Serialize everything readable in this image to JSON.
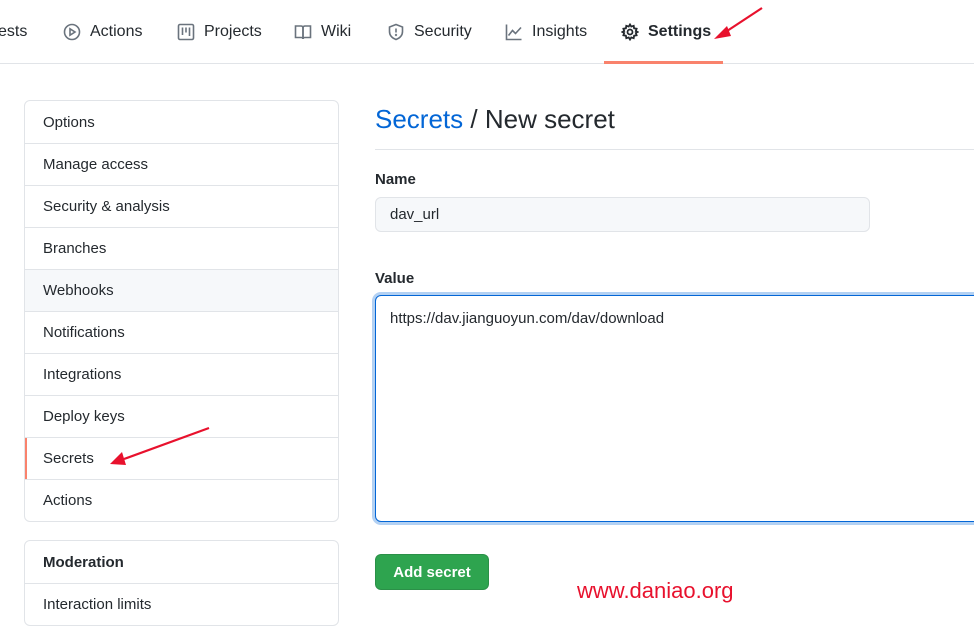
{
  "repo_nav": {
    "tabs": [
      {
        "label": "ests",
        "icon": "pull-request-icon"
      },
      {
        "label": "Actions",
        "icon": "play-icon"
      },
      {
        "label": "Projects",
        "icon": "project-board-icon"
      },
      {
        "label": "Wiki",
        "icon": "book-icon"
      },
      {
        "label": "Security",
        "icon": "shield-icon"
      },
      {
        "label": "Insights",
        "icon": "graph-icon"
      },
      {
        "label": "Settings",
        "icon": "gear-icon",
        "selected": true
      }
    ]
  },
  "sidebar": {
    "items": [
      {
        "label": "Options"
      },
      {
        "label": "Manage access"
      },
      {
        "label": "Security & analysis"
      },
      {
        "label": "Branches"
      },
      {
        "label": "Webhooks"
      },
      {
        "label": "Notifications"
      },
      {
        "label": "Integrations"
      },
      {
        "label": "Deploy keys"
      },
      {
        "label": "Secrets",
        "selected": true
      },
      {
        "label": "Actions"
      }
    ],
    "moderation": {
      "heading": "Moderation",
      "items": [
        {
          "label": "Interaction limits"
        }
      ]
    }
  },
  "main": {
    "breadcrumb_link": "Secrets",
    "separator": "/",
    "title": "New secret",
    "name_label": "Name",
    "name_value": "dav_url",
    "value_label": "Value",
    "value_text": "https://dav.jianguoyun.com/dav/download",
    "submit_label": "Add secret"
  },
  "watermark": "www.daniao.org",
  "colors": {
    "link": "#0366d6",
    "selected_accent": "#f9826c",
    "primary_button": "#2ea44f",
    "annotation_arrow": "#e8112d"
  }
}
